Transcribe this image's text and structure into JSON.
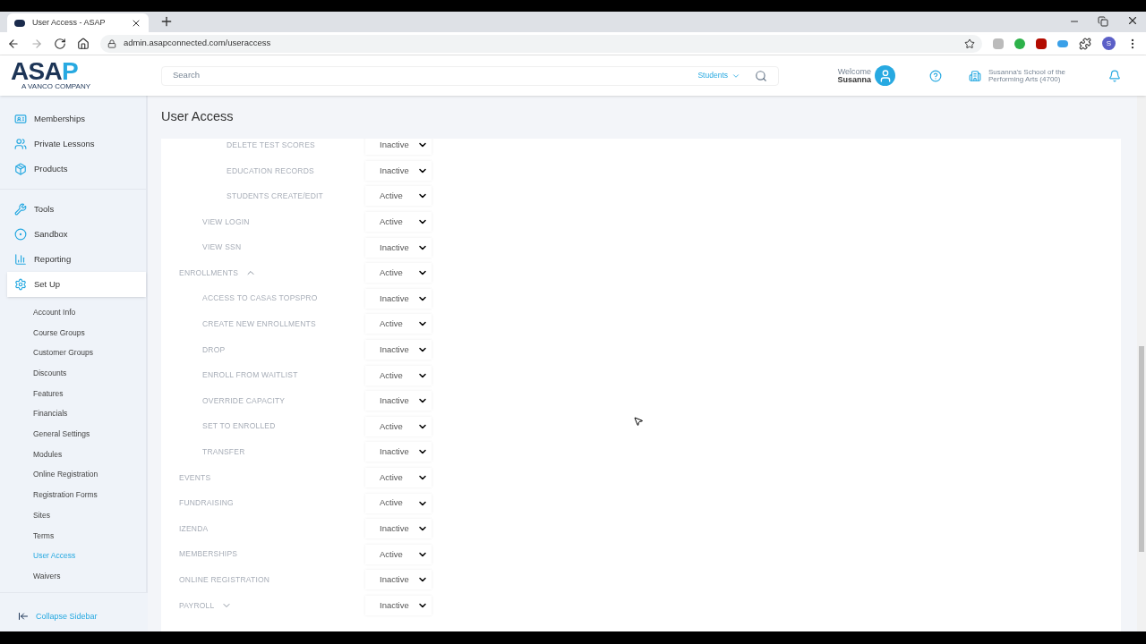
{
  "browser": {
    "tab_title": "User Access - ASAP",
    "url": "admin.asapconnected.com/useraccess",
    "profile_initial": "S"
  },
  "header": {
    "logo": {
      "main": "ASA",
      "accent": "P",
      "tagline": "A VANCO COMPANY"
    },
    "search_placeholder": "Search",
    "search_scope": "Students",
    "welcome": "Welcome",
    "user": "Susanna",
    "school": "Susanna's School of the Performing Arts (4700)"
  },
  "sidebar": {
    "nav_groups": [
      {
        "items": [
          {
            "label": "Memberships",
            "selected": false
          },
          {
            "label": "Private Lessons",
            "selected": false
          },
          {
            "label": "Products",
            "selected": false
          }
        ]
      },
      {
        "items": [
          {
            "label": "Tools",
            "selected": false
          },
          {
            "label": "Sandbox",
            "selected": false
          },
          {
            "label": "Reporting",
            "selected": false
          },
          {
            "label": "Set Up",
            "selected": true
          }
        ]
      }
    ],
    "sub_items": [
      {
        "label": "Account Info",
        "selected": false
      },
      {
        "label": "Course Groups",
        "selected": false
      },
      {
        "label": "Customer Groups",
        "selected": false
      },
      {
        "label": "Discounts",
        "selected": false
      },
      {
        "label": "Features",
        "selected": false
      },
      {
        "label": "Financials",
        "selected": false
      },
      {
        "label": "General Settings",
        "selected": false
      },
      {
        "label": "Modules",
        "selected": false
      },
      {
        "label": "Online Registration",
        "selected": false
      },
      {
        "label": "Registration Forms",
        "selected": false
      },
      {
        "label": "Sites",
        "selected": false
      },
      {
        "label": "Terms",
        "selected": false
      },
      {
        "label": "User Access",
        "selected": true
      },
      {
        "label": "Waivers",
        "selected": false
      }
    ],
    "collapse": "Collapse Sidebar"
  },
  "page_title": "User Access",
  "permissions": [
    {
      "children": [
        {
          "children": [
            {
              "label": "DELETE TEST SCORES",
              "status": "Inactive"
            },
            {
              "label": "EDUCATION RECORDS",
              "status": "Inactive"
            },
            {
              "label": "STUDENTS CREATE/EDIT",
              "status": "Active"
            }
          ]
        },
        {
          "label": "VIEW LOGIN",
          "status": "Active"
        },
        {
          "label": "VIEW SSN",
          "status": "Inactive"
        }
      ]
    },
    {
      "label": "ENROLLMENTS",
      "status": "Active",
      "expanded": true,
      "children": [
        {
          "label": "ACCESS TO CASAS TOPSPRO",
          "status": "Inactive"
        },
        {
          "label": "CREATE NEW ENROLLMENTS",
          "status": "Active"
        },
        {
          "label": "DROP",
          "status": "Inactive"
        },
        {
          "label": "ENROLL FROM WAITLIST",
          "status": "Active"
        },
        {
          "label": "OVERRIDE CAPACITY",
          "status": "Inactive"
        },
        {
          "label": "SET TO ENROLLED",
          "status": "Active"
        },
        {
          "label": "TRANSFER",
          "status": "Inactive"
        }
      ]
    },
    {
      "label": "EVENTS",
      "status": "Active"
    },
    {
      "label": "FUNDRAISING",
      "status": "Active"
    },
    {
      "label": "IZENDA",
      "status": "Inactive"
    },
    {
      "label": "MEMBERSHIPS",
      "status": "Active"
    },
    {
      "label": "ONLINE REGISTRATION",
      "status": "Inactive"
    },
    {
      "label": "PAYROLL",
      "status": "Inactive",
      "expanded": false
    }
  ]
}
